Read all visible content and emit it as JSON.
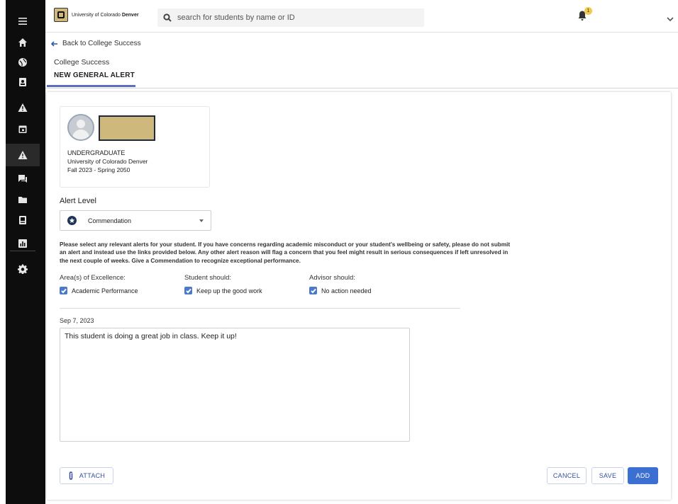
{
  "topbar": {
    "logo_prefix": "University of Colorado",
    "logo_bold": "Denver",
    "search_placeholder": "search for students by name or ID",
    "notification_count": "1"
  },
  "header": {
    "back_label": "Back to College Success",
    "breadcrumb": "College Success",
    "tab_label": "NEW GENERAL ALERT"
  },
  "student": {
    "level": "UNDERGRADUATE",
    "school": "University of Colorado Denver",
    "term": "Fall 2023 - Spring 2050"
  },
  "alert": {
    "label": "Alert Level",
    "selected": "Commendation",
    "instructions": "Please select any relevant alerts for your student. If you have concerns regarding academic misconduct or your student's wellbeing or safety, please do not submit an alert and instead use the links provided below. Any other alert reason will flag a concern that you feel might result in serious consequences if left unresolved in the next couple of weeks. Give a Commendation to recognize exceptional performance.",
    "columns": [
      {
        "header": "Area(s) of Excellence:",
        "option": "Academic Performance",
        "checked": true
      },
      {
        "header": "Student should:",
        "option": "Keep up the good work",
        "checked": true
      },
      {
        "header": "Advisor should:",
        "option": "No action needed",
        "checked": true
      }
    ]
  },
  "note": {
    "date": "Sep 7, 2023",
    "text": "This student is doing a great job in class. Keep it up!"
  },
  "actions": {
    "attach": "ATTACH",
    "cancel": "CANCEL",
    "save": "SAVE",
    "add": "ADD"
  },
  "colors": {
    "accent": "#3b6fd1",
    "sidebar": "#0d0d0d",
    "brand_gold": "#cfb87c",
    "tab_underline": "#5b6ec0"
  }
}
